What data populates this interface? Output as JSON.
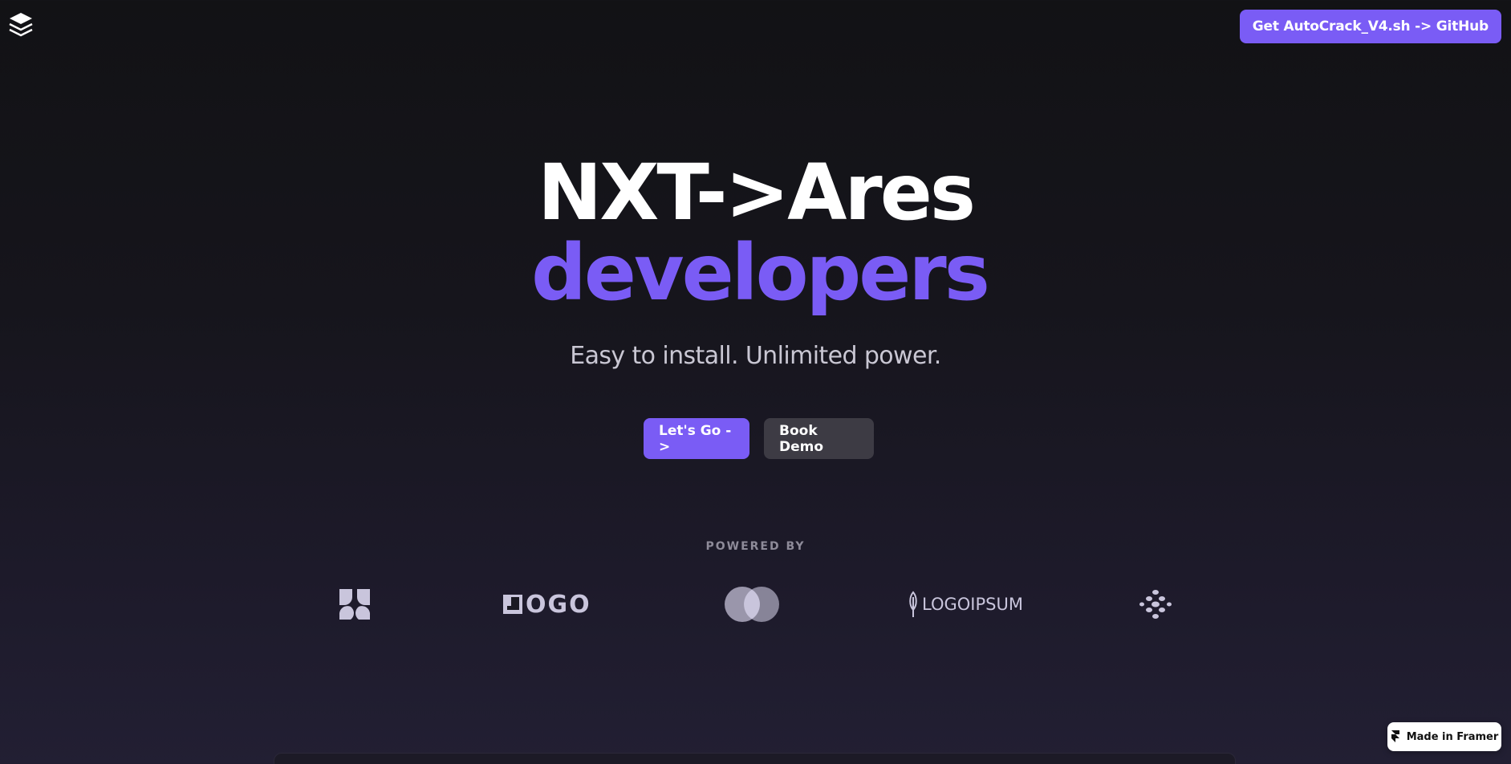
{
  "header": {
    "logo_icon": "layers-icon",
    "cta_label": "Get AutoCrack_V4.sh -> GitHub"
  },
  "hero": {
    "title_line1": "NXT->Ares",
    "title_line2": "developers",
    "subtitle": "Easy to install. Unlimited power."
  },
  "buttons": {
    "primary_label": "Let's Go ->",
    "secondary_label": "Book Demo"
  },
  "powered_by": {
    "heading": "POWERED BY",
    "logos": [
      {
        "icon": "petal-logo-icon"
      },
      {
        "icon": "logo-wordmark-icon",
        "text": "OGO"
      },
      {
        "icon": "overlapping-circles-logo-icon"
      },
      {
        "icon": "leaf-logo-icon",
        "text": "LOGOIPSUM"
      },
      {
        "icon": "dots-logo-icon"
      }
    ]
  },
  "badge": {
    "label": "Made in Framer",
    "icon": "framer-icon"
  },
  "colors": {
    "accent": "#7a5cf5",
    "background": "#121215",
    "secondary_button": "#3d3b44"
  }
}
